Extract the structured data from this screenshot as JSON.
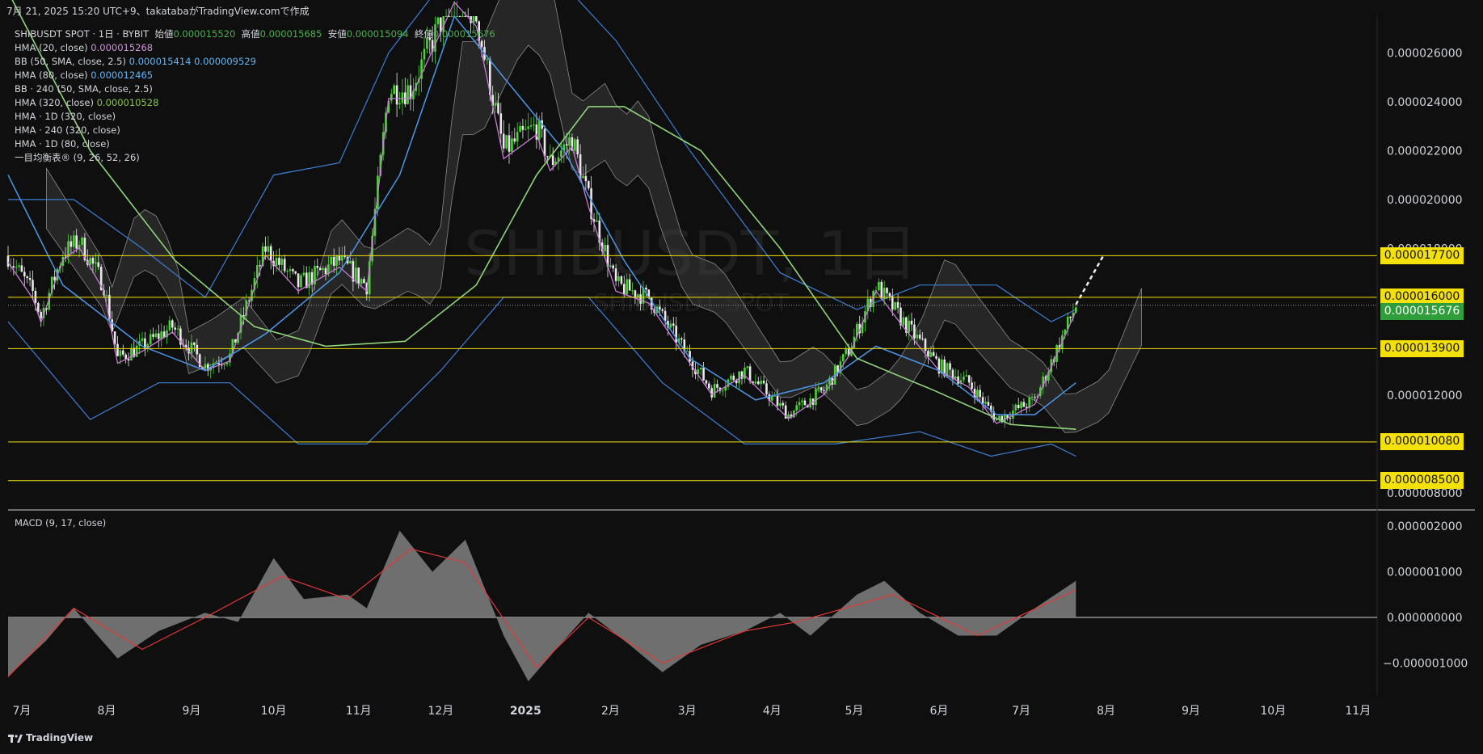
{
  "caption": "7月 21, 2025 15:20 UTC+9、takatabaがTradingView.comで作成",
  "brand": "TradingView",
  "watermark": {
    "main": "SHIBUSDT, 1日",
    "sub": "SHIBUSDT SPOT"
  },
  "legend": {
    "symbol_line": {
      "symbol": "SHIBUSDT SPOT · 1日 · BYBIT",
      "open_label": "始値",
      "open": "0.000015520",
      "high_label": "高値",
      "high": "0.000015685",
      "low_label": "安値",
      "low": "0.000015094",
      "close_label": "終値",
      "close": "0.000015676"
    },
    "indicators": [
      {
        "name": "HMA (20, close)",
        "value": "0.000015268",
        "color": "purple"
      },
      {
        "name": "BB (50, SMA, close, 2.5)",
        "value": "0.000015414  0.000009529",
        "color": "blue"
      },
      {
        "name": "HMA (80, close)",
        "value": "0.000012465",
        "color": "blue"
      },
      {
        "name": "BB · 240 (50, SMA, close, 2.5)",
        "value": "",
        "color": ""
      },
      {
        "name": "HMA (320, close)",
        "value": "0.000010528",
        "color": "lgreen"
      },
      {
        "name": "HMA · 1D (320, close)",
        "value": "",
        "color": ""
      },
      {
        "name": "HMA · 240 (320, close)",
        "value": "",
        "color": ""
      },
      {
        "name": "HMA · 1D (80, close)",
        "value": "",
        "color": ""
      },
      {
        "name": "一目均衡表® (9, 26, 52, 26)",
        "value": "",
        "color": ""
      }
    ]
  },
  "macd_legend": "MACD (9, 17, close)",
  "colors": {
    "up": "#4cd137",
    "down": "#e8e8e8",
    "hline": "#f5e10a",
    "bb": "#3d7fd6",
    "hma20": "#c77bd6",
    "hma80": "#4d97e8",
    "hma320": "#8fd47a",
    "cloud": "#3a3a3a",
    "macd": "#e53935",
    "hist": "#7a7a7a",
    "current": "#2e9d3a"
  },
  "chart_data": [
    {
      "type": "candlestick",
      "title": "",
      "y_axis_ticks": [
        "0.000026000",
        "0.000024000",
        "0.000022000",
        "0.000020000",
        "0.000018000",
        "0.000012000",
        "0.000008000"
      ],
      "y_range": [
        7.4e-06,
        2.75e-05
      ],
      "x_axis_ticks": [
        "7月",
        "8月",
        "9月",
        "10月",
        "11月",
        "12月",
        "2025",
        "2月",
        "3月",
        "4月",
        "5月",
        "6月",
        "7月",
        "8月",
        "9月",
        "10月",
        "11月"
      ],
      "x_range": [
        "2024-06-26",
        "2025-11-08"
      ],
      "horizontal_levels": [
        "0.000017700",
        "0.000016000",
        "0.000013900",
        "0.000010080",
        "0.000008500"
      ],
      "current_price": "0.000015676",
      "close_path": [
        {
          "date": "2024-06-26",
          "value": 1.77e-05
        },
        {
          "date": "2024-07-05",
          "value": 1.62e-05
        },
        {
          "date": "2024-07-08",
          "value": 1.52e-05
        },
        {
          "date": "2024-07-16",
          "value": 1.78e-05
        },
        {
          "date": "2024-07-22",
          "value": 1.83e-05
        },
        {
          "date": "2024-07-31",
          "value": 1.65e-05
        },
        {
          "date": "2024-08-05",
          "value": 1.35e-05
        },
        {
          "date": "2024-08-14",
          "value": 1.4e-05
        },
        {
          "date": "2024-08-25",
          "value": 1.48e-05
        },
        {
          "date": "2024-09-06",
          "value": 1.32e-05
        },
        {
          "date": "2024-09-15",
          "value": 1.36e-05
        },
        {
          "date": "2024-09-28",
          "value": 1.8e-05
        },
        {
          "date": "2024-10-10",
          "value": 1.65e-05
        },
        {
          "date": "2024-10-25",
          "value": 1.75e-05
        },
        {
          "date": "2024-11-04",
          "value": 1.65e-05
        },
        {
          "date": "2024-11-12",
          "value": 2.45e-05
        },
        {
          "date": "2024-11-20",
          "value": 2.45e-05
        },
        {
          "date": "2024-12-06",
          "value": 2.85e-05
        },
        {
          "date": "2024-12-14",
          "value": 2.75e-05
        },
        {
          "date": "2024-12-24",
          "value": 2.2e-05
        },
        {
          "date": "2025-01-05",
          "value": 2.3e-05
        },
        {
          "date": "2025-01-10",
          "value": 2.15e-05
        },
        {
          "date": "2025-01-18",
          "value": 2.25e-05
        },
        {
          "date": "2025-01-24",
          "value": 2e-05
        },
        {
          "date": "2025-02-03",
          "value": 1.65e-05
        },
        {
          "date": "2025-02-15",
          "value": 1.6e-05
        },
        {
          "date": "2025-02-27",
          "value": 1.4e-05
        },
        {
          "date": "2025-03-10",
          "value": 1.22e-05
        },
        {
          "date": "2025-03-22",
          "value": 1.3e-05
        },
        {
          "date": "2025-04-07",
          "value": 1.12e-05
        },
        {
          "date": "2025-04-20",
          "value": 1.22e-05
        },
        {
          "date": "2025-04-29",
          "value": 1.38e-05
        },
        {
          "date": "2025-05-09",
          "value": 1.65e-05
        },
        {
          "date": "2025-05-19",
          "value": 1.5e-05
        },
        {
          "date": "2025-06-01",
          "value": 1.32e-05
        },
        {
          "date": "2025-06-12",
          "value": 1.25e-05
        },
        {
          "date": "2025-06-22",
          "value": 1.1e-05
        },
        {
          "date": "2025-07-06",
          "value": 1.18e-05
        },
        {
          "date": "2025-07-21",
          "value": 1.5676e-05
        }
      ],
      "projection": [
        {
          "date": "2025-07-21",
          "value": 1.57e-05
        },
        {
          "date": "2025-07-31",
          "value": 1.77e-05
        }
      ],
      "hma320": [
        {
          "date": "2024-06-26",
          "value": 2.85e-05
        },
        {
          "date": "2024-07-26",
          "value": 2.2e-05
        },
        {
          "date": "2024-08-26",
          "value": 1.75e-05
        },
        {
          "date": "2024-09-24",
          "value": 1.48e-05
        },
        {
          "date": "2024-10-20",
          "value": 1.4e-05
        },
        {
          "date": "2024-11-18",
          "value": 1.42e-05
        },
        {
          "date": "2024-12-14",
          "value": 1.65e-05
        },
        {
          "date": "2025-01-05",
          "value": 2.1e-05
        },
        {
          "date": "2025-01-24",
          "value": 2.38e-05
        },
        {
          "date": "2025-02-06",
          "value": 2.38e-05
        },
        {
          "date": "2025-03-06",
          "value": 2.2e-05
        },
        {
          "date": "2025-04-04",
          "value": 1.8e-05
        },
        {
          "date": "2025-05-02",
          "value": 1.35e-05
        },
        {
          "date": "2025-05-30",
          "value": 1.22e-05
        },
        {
          "date": "2025-06-27",
          "value": 1.08e-05
        },
        {
          "date": "2025-07-21",
          "value": 1.06e-05
        }
      ],
      "hma80": [
        {
          "date": "2024-06-26",
          "value": 2.1e-05
        },
        {
          "date": "2024-07-16",
          "value": 1.65e-05
        },
        {
          "date": "2024-08-14",
          "value": 1.4e-05
        },
        {
          "date": "2024-09-06",
          "value": 1.3e-05
        },
        {
          "date": "2024-09-28",
          "value": 1.45e-05
        },
        {
          "date": "2024-10-25",
          "value": 1.7e-05
        },
        {
          "date": "2024-11-16",
          "value": 2.1e-05
        },
        {
          "date": "2024-12-06",
          "value": 2.75e-05
        },
        {
          "date": "2024-12-24",
          "value": 2.5e-05
        },
        {
          "date": "2025-01-15",
          "value": 2.2e-05
        },
        {
          "date": "2025-02-06",
          "value": 1.75e-05
        },
        {
          "date": "2025-03-02",
          "value": 1.35e-05
        },
        {
          "date": "2025-03-26",
          "value": 1.18e-05
        },
        {
          "date": "2025-04-20",
          "value": 1.25e-05
        },
        {
          "date": "2025-05-09",
          "value": 1.4e-05
        },
        {
          "date": "2025-06-01",
          "value": 1.3e-05
        },
        {
          "date": "2025-06-22",
          "value": 1.12e-05
        },
        {
          "date": "2025-07-06",
          "value": 1.12e-05
        },
        {
          "date": "2025-07-21",
          "value": 1.25e-05
        }
      ],
      "bb_upper": [
        {
          "date": "2024-06-26",
          "value": 2e-05
        },
        {
          "date": "2024-07-20",
          "value": 2e-05
        },
        {
          "date": "2024-08-14",
          "value": 1.8e-05
        },
        {
          "date": "2024-09-06",
          "value": 1.6e-05
        },
        {
          "date": "2024-10-01",
          "value": 2.1e-05
        },
        {
          "date": "2024-10-25",
          "value": 2.15e-05
        },
        {
          "date": "2024-11-12",
          "value": 2.6e-05
        },
        {
          "date": "2024-12-06",
          "value": 2.95e-05
        },
        {
          "date": "2025-01-05",
          "value": 3e-05
        },
        {
          "date": "2025-02-03",
          "value": 2.65e-05
        },
        {
          "date": "2025-03-02",
          "value": 2.2e-05
        },
        {
          "date": "2025-04-04",
          "value": 1.7e-05
        },
        {
          "date": "2025-05-02",
          "value": 1.55e-05
        },
        {
          "date": "2025-05-25",
          "value": 1.65e-05
        },
        {
          "date": "2025-06-22",
          "value": 1.65e-05
        },
        {
          "date": "2025-07-12",
          "value": 1.5e-05
        },
        {
          "date": "2025-07-21",
          "value": 1.55e-05
        }
      ],
      "bb_lower": [
        {
          "date": "2024-06-26",
          "value": 1.5e-05
        },
        {
          "date": "2024-07-26",
          "value": 1.1e-05
        },
        {
          "date": "2024-08-20",
          "value": 1.25e-05
        },
        {
          "date": "2024-09-15",
          "value": 1.25e-05
        },
        {
          "date": "2024-10-10",
          "value": 1e-05
        },
        {
          "date": "2024-11-04",
          "value": 1e-05
        },
        {
          "date": "2024-12-01",
          "value": 1.3e-05
        },
        {
          "date": "2024-12-24",
          "value": 1.6e-05
        },
        {
          "date": "2025-01-24",
          "value": 1.6e-05
        },
        {
          "date": "2025-02-20",
          "value": 1.25e-05
        },
        {
          "date": "2025-03-22",
          "value": 1e-05
        },
        {
          "date": "2025-04-24",
          "value": 1e-05
        },
        {
          "date": "2025-05-25",
          "value": 1.05e-05
        },
        {
          "date": "2025-06-20",
          "value": 9.5e-06
        },
        {
          "date": "2025-07-12",
          "value": 1e-05
        },
        {
          "date": "2025-07-21",
          "value": 9.5e-06
        }
      ]
    },
    {
      "type": "area",
      "title": "MACD (9, 17, close)",
      "y_axis_ticks": [
        "0.000002000",
        "0.000001000",
        "0.000000000",
        "−0.000001000"
      ],
      "y_range": [
        -1.7e-06,
        2.3e-06
      ],
      "histogram": [
        {
          "date": "2024-06-26",
          "value": -1.3e-06
        },
        {
          "date": "2024-07-10",
          "value": -5e-07
        },
        {
          "date": "2024-07-20",
          "value": 2e-07
        },
        {
          "date": "2024-08-05",
          "value": -9e-07
        },
        {
          "date": "2024-08-20",
          "value": -3e-07
        },
        {
          "date": "2024-09-06",
          "value": 1e-07
        },
        {
          "date": "2024-09-18",
          "value": -1e-07
        },
        {
          "date": "2024-10-01",
          "value": 1.3e-06
        },
        {
          "date": "2024-10-12",
          "value": 4e-07
        },
        {
          "date": "2024-10-28",
          "value": 5e-07
        },
        {
          "date": "2024-11-04",
          "value": 2e-07
        },
        {
          "date": "2024-11-16",
          "value": 1.9e-06
        },
        {
          "date": "2024-11-28",
          "value": 1e-06
        },
        {
          "date": "2024-12-10",
          "value": 1.7e-06
        },
        {
          "date": "2024-12-24",
          "value": -4e-07
        },
        {
          "date": "2025-01-02",
          "value": -1.4e-06
        },
        {
          "date": "2025-01-15",
          "value": -5e-07
        },
        {
          "date": "2025-01-24",
          "value": 1e-07
        },
        {
          "date": "2025-02-08",
          "value": -6e-07
        },
        {
          "date": "2025-02-20",
          "value": -1.2e-06
        },
        {
          "date": "2025-03-06",
          "value": -6e-07
        },
        {
          "date": "2025-03-22",
          "value": -3e-07
        },
        {
          "date": "2025-04-04",
          "value": 1e-07
        },
        {
          "date": "2025-04-15",
          "value": -4e-07
        },
        {
          "date": "2025-05-02",
          "value": 5e-07
        },
        {
          "date": "2025-05-12",
          "value": 8e-07
        },
        {
          "date": "2025-05-25",
          "value": 1e-07
        },
        {
          "date": "2025-06-08",
          "value": -4e-07
        },
        {
          "date": "2025-06-22",
          "value": -4e-07
        },
        {
          "date": "2025-07-06",
          "value": 2e-07
        },
        {
          "date": "2025-07-21",
          "value": 8e-07
        }
      ],
      "signal": [
        {
          "date": "2024-06-26",
          "value": -1.3e-06
        },
        {
          "date": "2024-07-20",
          "value": 2e-07
        },
        {
          "date": "2024-08-14",
          "value": -7e-07
        },
        {
          "date": "2024-09-06",
          "value": 0.0
        },
        {
          "date": "2024-10-04",
          "value": 9e-07
        },
        {
          "date": "2024-10-28",
          "value": 4e-07
        },
        {
          "date": "2024-11-20",
          "value": 1.5e-06
        },
        {
          "date": "2024-12-10",
          "value": 1.2e-06
        },
        {
          "date": "2025-01-05",
          "value": -1.1e-06
        },
        {
          "date": "2025-01-24",
          "value": 0.0
        },
        {
          "date": "2025-02-20",
          "value": -1e-06
        },
        {
          "date": "2025-03-22",
          "value": -3e-07
        },
        {
          "date": "2025-04-10",
          "value": -1e-07
        },
        {
          "date": "2025-05-15",
          "value": 5e-07
        },
        {
          "date": "2025-06-15",
          "value": -4e-07
        },
        {
          "date": "2025-07-21",
          "value": 6e-07
        }
      ]
    }
  ]
}
